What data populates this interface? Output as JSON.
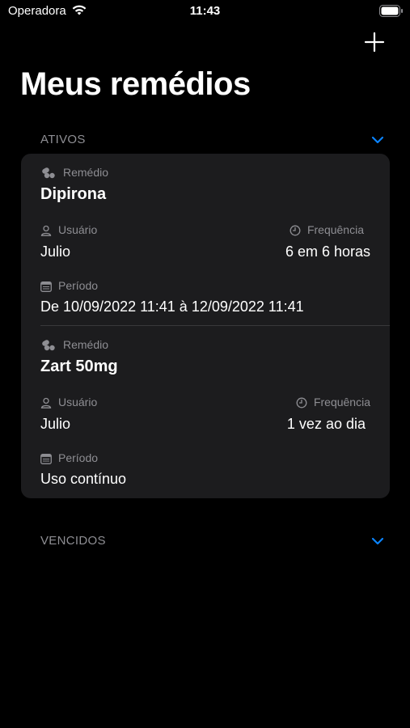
{
  "status_bar": {
    "carrier": "Operadora",
    "time": "11:43"
  },
  "nav": {
    "add_icon": "plus-icon"
  },
  "title": "Meus remédios",
  "sections": {
    "ativos": {
      "label": "ATIVOS",
      "icon": "chevron-down-icon"
    },
    "vencidos": {
      "label": "VENCIDOS",
      "icon": "chevron-down-icon"
    }
  },
  "labels": {
    "remedio": "Remédio",
    "usuario": "Usuário",
    "frequencia": "Frequência",
    "periodo": "Período"
  },
  "medications": [
    {
      "name": "Dipirona",
      "user": "Julio",
      "frequency": "6 em 6 horas",
      "period": "De 10/09/2022 11:41 à 12/09/2022 11:41"
    },
    {
      "name": "Zart 50mg",
      "user": "Julio",
      "frequency": "1 vez ao dia",
      "period": "Uso contínuo"
    }
  ],
  "colors": {
    "background": "#000000",
    "card": "#1c1c1e",
    "secondary_text": "#8e8e93",
    "accent": "#0a84ff"
  }
}
